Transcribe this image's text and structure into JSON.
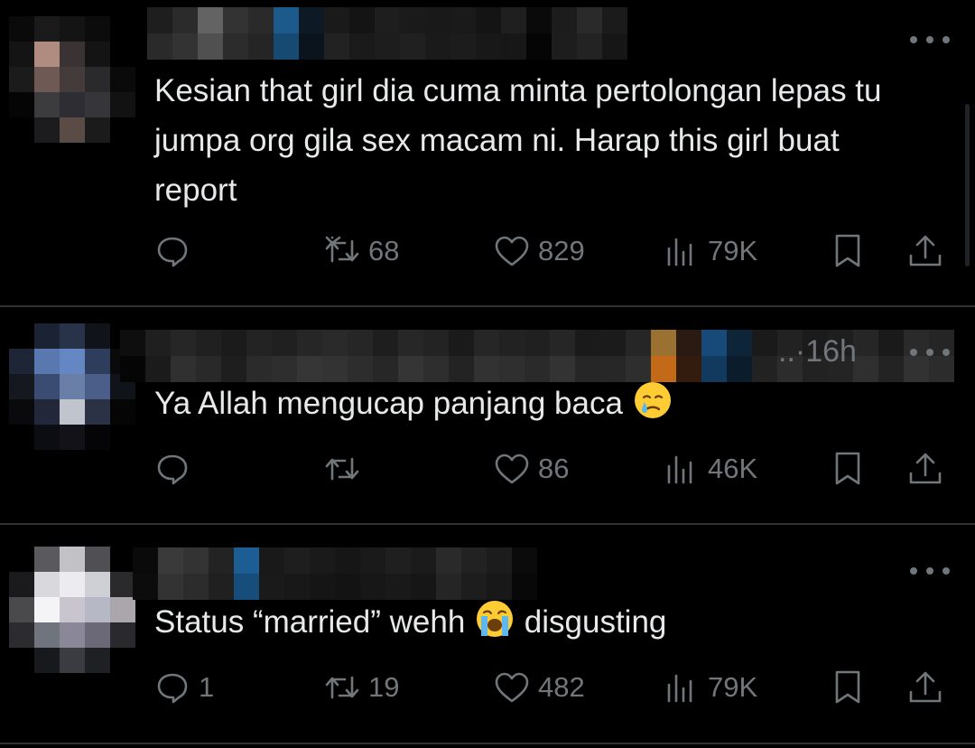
{
  "replies": [
    {
      "time": "",
      "text": "Kesian that girl dia cuma minta pertolongan lepas tu jumpa org gila sex macam ni. Harap this girl buat report",
      "actions": {
        "replies": "",
        "reposts": "68",
        "likes": "829",
        "views": "79K"
      }
    },
    {
      "time": "·16h",
      "truncation": "..",
      "text": "Ya Allah mengucap panjang baca",
      "emoji": "crying-face",
      "actions": {
        "replies": "",
        "reposts": "",
        "likes": "86",
        "views": "46K"
      }
    },
    {
      "text_before": "Status “married” wehh",
      "emoji": "loudly-crying-face",
      "text_after": "disgusting",
      "actions": {
        "replies": "1",
        "reposts": "19",
        "likes": "482",
        "views": "79K"
      }
    }
  ],
  "icons": {
    "reply": "speech-bubble-icon",
    "repost": "repost-arrows-icon",
    "like": "heart-icon",
    "views": "bar-chart-icon",
    "bookmark": "bookmark-icon",
    "share": "share-upload-icon",
    "more": "more-dots-icon"
  },
  "colors": {
    "background": "#000000",
    "text": "#e7e9ea",
    "muted": "#71767b",
    "divider": "#2f3336"
  }
}
